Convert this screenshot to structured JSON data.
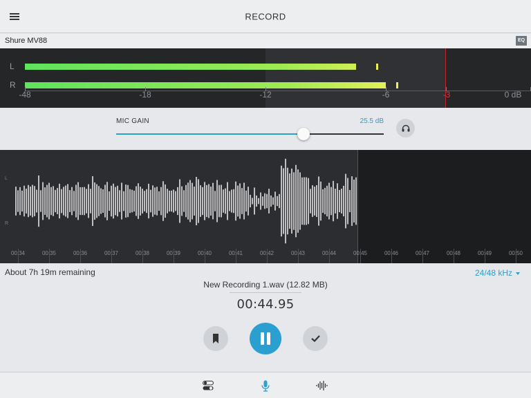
{
  "header": {
    "title": "RECORD",
    "menu_icon": "hamburger-menu-icon"
  },
  "device": {
    "name": "Shure MV88",
    "eq_label": "EQ"
  },
  "level_meter": {
    "channels": [
      {
        "label": "L",
        "level_db": -7.5,
        "peak_db": -6.5
      },
      {
        "label": "R",
        "level_db": -6.0,
        "peak_db": -5.5
      }
    ],
    "scale": [
      "-48",
      "-18",
      "-12",
      "-6",
      "-3",
      "0 dB"
    ],
    "clip_threshold": "-3"
  },
  "gain": {
    "label": "MIC GAIN",
    "value": "25.5 dB",
    "slider_fraction": 0.7,
    "monitor_icon": "headphones-icon"
  },
  "waveform": {
    "channel_labels": [
      "L",
      "R"
    ],
    "times": [
      "00:34",
      "00:35",
      "00:36",
      "00:37",
      "00:38",
      "00:39",
      "00:40",
      "00:41",
      "00:42",
      "00:43",
      "00:44",
      "00:45",
      "00:46",
      "00:47",
      "00:48",
      "00:49",
      "00:50"
    ]
  },
  "recording": {
    "remaining": "About 7h 19m remaining",
    "sample_rate": "24/48 kHz",
    "filename": "New Recording 1.wav (12.82 MB)",
    "elapsed": "00:44.95"
  },
  "controls": {
    "marker_icon": "bookmark-icon",
    "pause_icon": "pause-icon",
    "done_icon": "checkmark-icon"
  },
  "tabs": [
    {
      "name": "settings",
      "icon": "toggles-icon",
      "active": false
    },
    {
      "name": "record",
      "icon": "microphone-icon",
      "active": true
    },
    {
      "name": "files",
      "icon": "waveform-icon",
      "active": false
    }
  ],
  "colors": {
    "accent": "#2a9fd0",
    "clip_red": "#c0262d",
    "meter_green": "#5fe35d",
    "meter_yellow": "#eef05a"
  }
}
